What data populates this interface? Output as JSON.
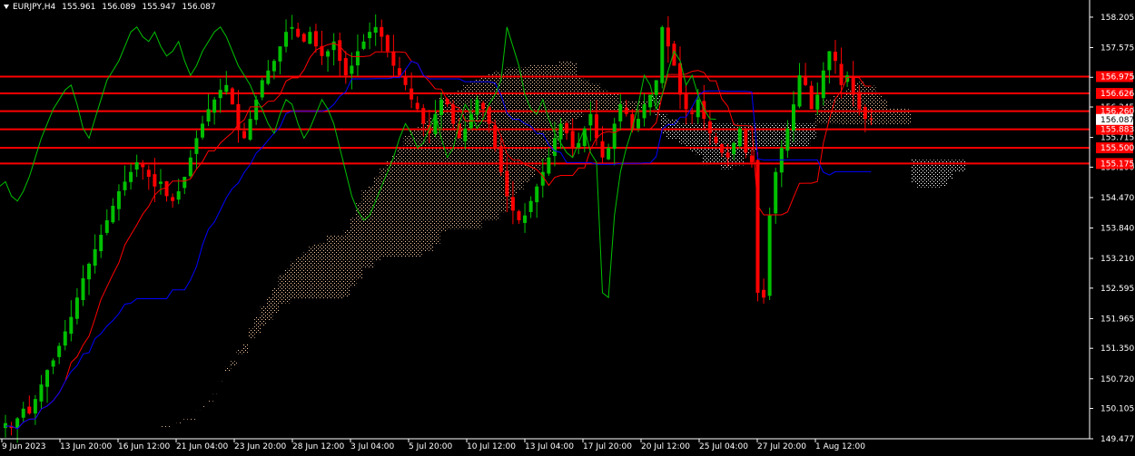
{
  "info_bar": {
    "symbol_tf": "EURJPY,H4",
    "open": "155.961",
    "high": "156.089",
    "low": "155.947",
    "close": "156.087"
  },
  "colors": {
    "background": "#000000",
    "bull_candle": "#00c000",
    "bear_candle": "#ff0000",
    "tenkan": "#ff0000",
    "kijun": "#0000ff",
    "chikou": "#00c000",
    "cloud_up": "#f4c7a0",
    "cloud_down": "#ffffff",
    "hline": "#ff0000",
    "axis_text": "#ffffff"
  },
  "chart_data": {
    "type": "candlestick",
    "title": "EURJPY,H4",
    "ylim": [
      149.477,
      158.41
    ],
    "y_ticks": [
      "158.205",
      "157.575",
      "156.960",
      "156.345",
      "155.715",
      "155.100",
      "154.470",
      "153.840",
      "153.210",
      "152.595",
      "151.965",
      "151.350",
      "150.720",
      "150.105",
      "149.477"
    ],
    "x_ticks": [
      "9 Jun 2023",
      "13 Jun 20:00",
      "16 Jun 12:00",
      "21 Jun 04:00",
      "23 Jun 20:00",
      "28 Jun 12:00",
      "3 Jul 04:00",
      "5 Jul 20:00",
      "10 Jul 12:00",
      "13 Jul 04:00",
      "17 Jul 20:00",
      "20 Jul 12:00",
      "25 Jul 04:00",
      "27 Jul 20:00",
      "1 Aug 12:00"
    ],
    "current_price": "156.087",
    "horizontal_levels": [
      {
        "label": "156.975",
        "value": 156.975
      },
      {
        "label": "156.626",
        "value": 156.626
      },
      {
        "label": "156.260",
        "value": 156.26
      },
      {
        "label": "155.883",
        "value": 155.883
      },
      {
        "label": "155.500",
        "value": 155.5
      },
      {
        "label": "155.175",
        "value": 155.175
      }
    ],
    "close_series": [
      149.8,
      149.7,
      149.9,
      150.1,
      150.0,
      150.3,
      150.6,
      150.9,
      151.1,
      151.4,
      151.7,
      152.0,
      152.4,
      152.8,
      153.1,
      153.4,
      153.7,
      154.0,
      154.3,
      154.6,
      154.8,
      155.0,
      155.2,
      155.1,
      154.9,
      154.7,
      154.8,
      154.5,
      154.4,
      154.6,
      154.9,
      155.3,
      155.7,
      156.0,
      156.3,
      156.5,
      156.7,
      156.8,
      156.4,
      155.9,
      155.7,
      156.1,
      156.5,
      156.9,
      157.1,
      157.3,
      157.6,
      157.9,
      158.0,
      157.8,
      157.7,
      157.9,
      157.6,
      157.4,
      157.5,
      157.7,
      157.3,
      157.0,
      157.2,
      157.5,
      157.7,
      157.9,
      158.0,
      157.8,
      157.5,
      157.2,
      157.0,
      156.8,
      156.5,
      156.3,
      156.0,
      155.8,
      156.2,
      156.5,
      156.4,
      156.0,
      155.7,
      155.9,
      156.2,
      156.5,
      156.3,
      156.0,
      155.5,
      155.0,
      154.5,
      154.2,
      154.0,
      154.1,
      154.4,
      154.7,
      155.0,
      155.3,
      155.7,
      156.0,
      155.8,
      155.5,
      155.6,
      155.9,
      156.2,
      155.7,
      155.3,
      155.5,
      156.0,
      156.4,
      156.2,
      155.9,
      156.1,
      156.4,
      156.6,
      156.9,
      158.0,
      157.6,
      157.2,
      156.6,
      156.3,
      156.2,
      156.5,
      156.1,
      155.8,
      155.6,
      155.4,
      155.3,
      155.6,
      155.9,
      155.4,
      155.2,
      152.5,
      152.4,
      154.1,
      155.0,
      155.5,
      155.9,
      156.4,
      157.0,
      156.8,
      156.3,
      156.6,
      157.1,
      157.5,
      157.3,
      156.8,
      157.0,
      156.6,
      156.3,
      156.1,
      156.09
    ]
  }
}
